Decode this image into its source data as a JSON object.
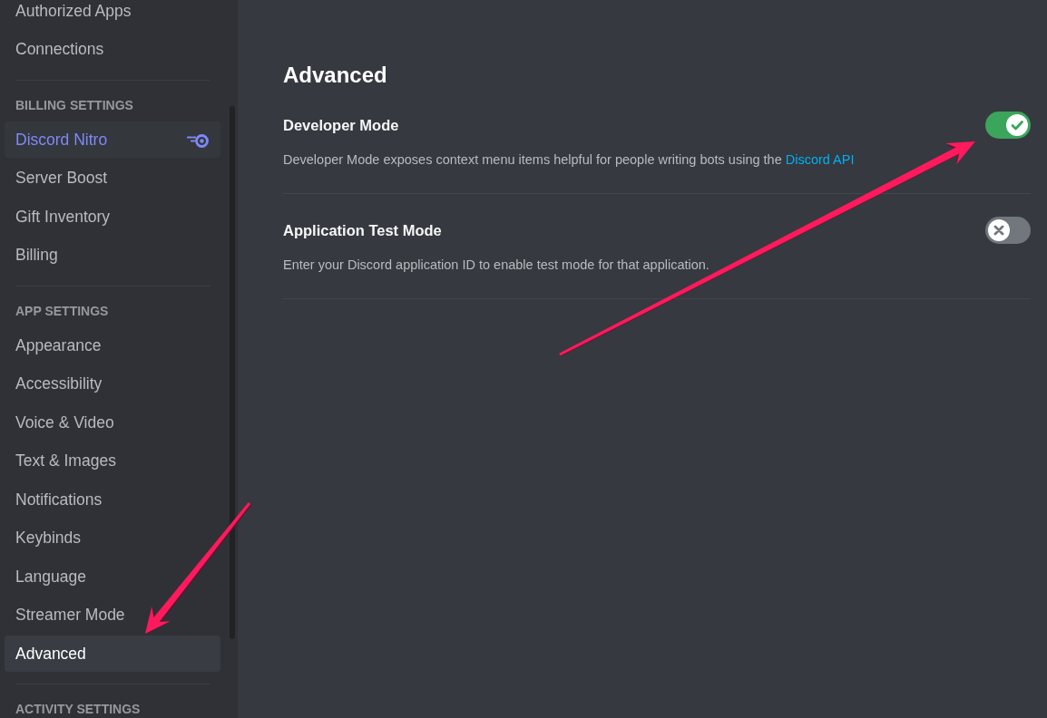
{
  "sidebar": {
    "sections": [
      {
        "items": [
          {
            "label": "Authorized Apps",
            "kind": "item",
            "selected": false
          },
          {
            "label": "Connections",
            "kind": "item",
            "selected": false
          }
        ]
      },
      {
        "header": "BILLING SETTINGS",
        "items": [
          {
            "label": "Discord Nitro",
            "kind": "nitro",
            "selected": false
          },
          {
            "label": "Server Boost",
            "kind": "item",
            "selected": false
          },
          {
            "label": "Gift Inventory",
            "kind": "item",
            "selected": false
          },
          {
            "label": "Billing",
            "kind": "item",
            "selected": false
          }
        ]
      },
      {
        "header": "APP SETTINGS",
        "items": [
          {
            "label": "Appearance",
            "kind": "item",
            "selected": false
          },
          {
            "label": "Accessibility",
            "kind": "item",
            "selected": false
          },
          {
            "label": "Voice & Video",
            "kind": "item",
            "selected": false
          },
          {
            "label": "Text & Images",
            "kind": "item",
            "selected": false
          },
          {
            "label": "Notifications",
            "kind": "item",
            "selected": false
          },
          {
            "label": "Keybinds",
            "kind": "item",
            "selected": false
          },
          {
            "label": "Language",
            "kind": "item",
            "selected": false
          },
          {
            "label": "Streamer Mode",
            "kind": "item",
            "selected": false
          },
          {
            "label": "Advanced",
            "kind": "item",
            "selected": true
          }
        ]
      },
      {
        "header": "ACTIVITY SETTINGS"
      }
    ]
  },
  "main": {
    "title": "Advanced",
    "settings": [
      {
        "title": "Developer Mode",
        "on": true,
        "description": "Developer Mode exposes context menu items helpful for people writing bots using the",
        "link": "Discord API"
      },
      {
        "title": "Application Test Mode",
        "on": false,
        "description": "Enter your Discord application ID to enable test mode for that application."
      }
    ]
  }
}
